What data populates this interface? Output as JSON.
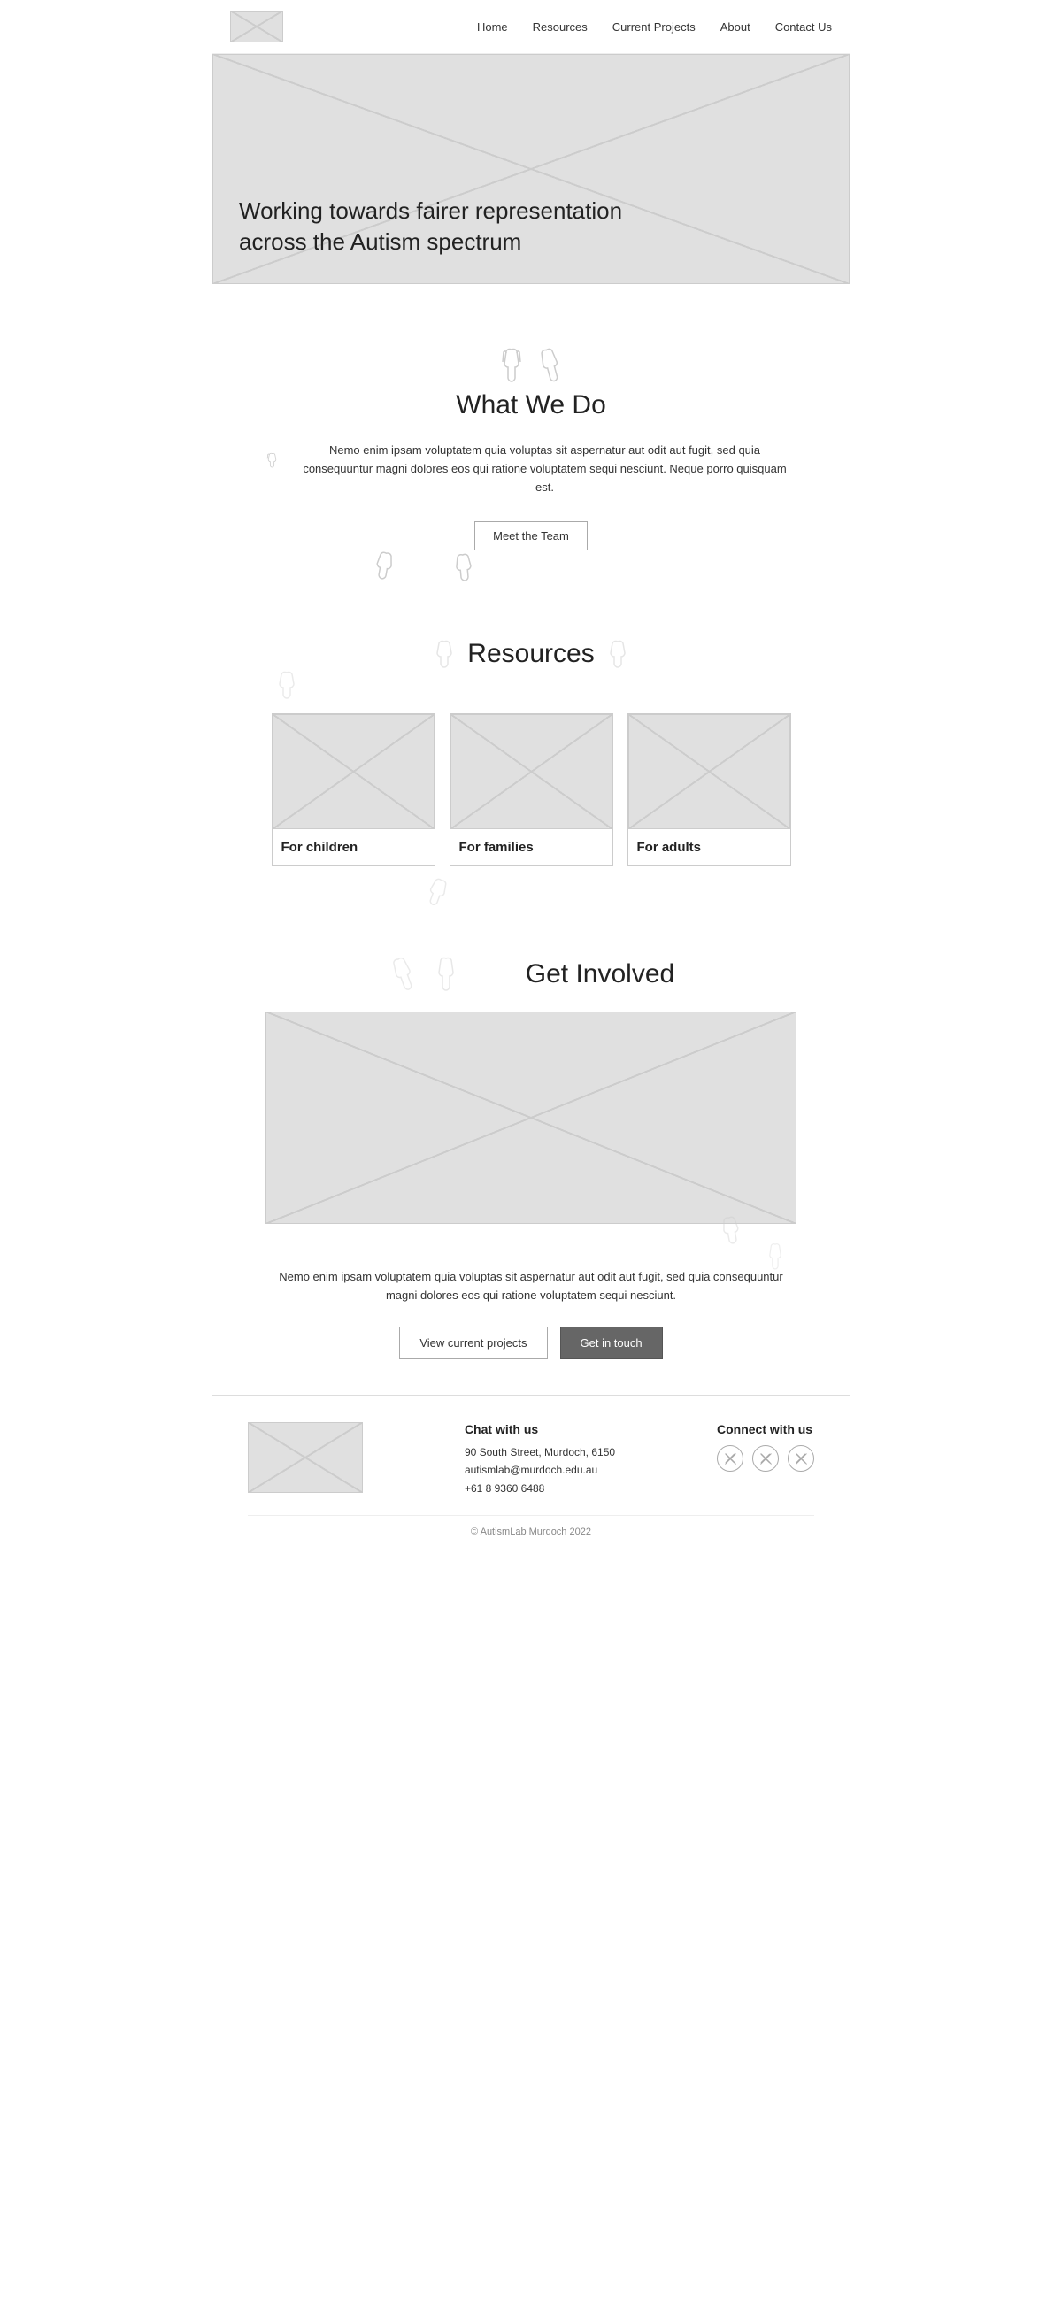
{
  "nav": {
    "logo_alt": "AutismLab Logo",
    "links": [
      {
        "label": "Home",
        "href": "#"
      },
      {
        "label": "Resources",
        "href": "#"
      },
      {
        "label": "Current Projects",
        "href": "#"
      },
      {
        "label": "About",
        "href": "#"
      },
      {
        "label": "Contact Us",
        "href": "#"
      }
    ]
  },
  "hero": {
    "tagline_line1": "Working towards fairer representation",
    "tagline_line2": "across the Autism spectrum"
  },
  "what_we_do": {
    "title": "What We Do",
    "body": "Nemo enim ipsam voluptatem quia voluptas sit aspernatur aut odit aut fugit, sed quia consequuntur magni dolores eos qui ratione voluptatem sequi nesciunt. Neque porro quisquam est.",
    "cta_label": "Meet the Team"
  },
  "resources": {
    "title": "Resources",
    "cards": [
      {
        "label": "For children"
      },
      {
        "label": "For families"
      },
      {
        "label": "For adults"
      }
    ]
  },
  "get_involved": {
    "title": "Get Involved",
    "body": "Nemo enim ipsam voluptatem quia voluptas sit aspernatur aut odit aut fugit, sed quia consequuntur magni dolores eos qui ratione voluptatem sequi nesciunt.",
    "btn_projects": "View current projects",
    "btn_touch": "Get in touch"
  },
  "footer": {
    "logo_alt": "AutismLab Logo",
    "chat_title": "Chat with us",
    "address": "90 South Street, Murdoch, 6150",
    "email": "autismlab@murdoch.edu.au",
    "phone": "+61 8 9360 6488",
    "social_title": "Connect with us",
    "social_icons": [
      "x",
      "x",
      "x"
    ],
    "copyright": "© AutismLab Murdoch 2022"
  }
}
